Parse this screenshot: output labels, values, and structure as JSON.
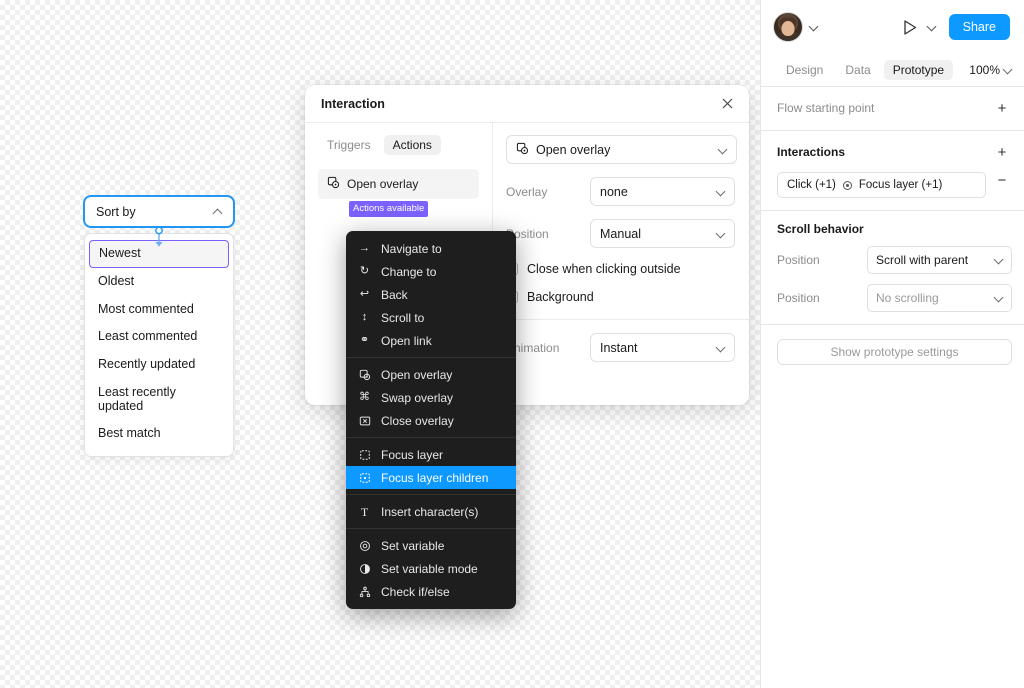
{
  "canvas": {
    "sort_dropdown": {
      "trigger_label": "Sort by",
      "caret_icon": "chevron-up-icon",
      "options": [
        "Newest",
        "Oldest",
        "Most commented",
        "Least commented",
        "Recently updated",
        "Least recently updated",
        "Best match"
      ],
      "selected_option": "Newest",
      "selection_color": "#2196f3",
      "option_highlight_color": "#7b61ff"
    }
  },
  "interaction_dialog": {
    "title": "Interaction",
    "close_icon": "close-icon",
    "tabs": [
      {
        "label": "Triggers",
        "active": false
      },
      {
        "label": "Actions",
        "active": true
      }
    ],
    "action_item": {
      "label": "Open overlay",
      "icon": "open-overlay-icon"
    },
    "badge": "Actions available",
    "badge_color": "#7b61ff",
    "add_node_icon": "add-interaction-icon",
    "action_select": {
      "label": "Open overlay",
      "icon": "open-overlay-icon",
      "caret_icon": "chevron-down-icon"
    },
    "fields": [
      {
        "name": "Overlay",
        "value": "none"
      },
      {
        "name": "Position",
        "value": "Manual"
      }
    ],
    "checkboxes": [
      {
        "label": "Close when clicking outside",
        "checked": false
      },
      {
        "label": "Background",
        "checked": false
      }
    ],
    "animation": {
      "name": "Animation",
      "value": "Instant"
    }
  },
  "action_menu": {
    "groups": [
      {
        "items": [
          {
            "label": "Navigate to",
            "icon": "arrow-right-icon",
            "glyph": "→",
            "highlight": false
          },
          {
            "label": "Change to",
            "icon": "swap-circular-icon",
            "glyph": "↻",
            "highlight": false
          },
          {
            "label": "Back",
            "icon": "arrow-back-icon",
            "glyph": "↩",
            "highlight": false
          },
          {
            "label": "Scroll to",
            "icon": "scroll-to-icon",
            "glyph": "↕",
            "highlight": false
          },
          {
            "label": "Open link",
            "icon": "link-icon",
            "glyph": "⚭",
            "highlight": false
          }
        ]
      },
      {
        "items": [
          {
            "label": "Open overlay",
            "icon": "open-overlay-icon",
            "glyph": "⧉",
            "highlight": false
          },
          {
            "label": "Swap overlay",
            "icon": "swap-overlay-icon",
            "glyph": "⌘",
            "highlight": false
          },
          {
            "label": "Close overlay",
            "icon": "close-overlay-icon",
            "glyph": "⊠",
            "highlight": false
          }
        ]
      },
      {
        "items": [
          {
            "label": "Focus layer",
            "icon": "focus-layer-icon",
            "glyph": "⬚",
            "highlight": false
          },
          {
            "label": "Focus layer children",
            "icon": "focus-layer-children-icon",
            "glyph": "⬚",
            "highlight": true
          }
        ]
      },
      {
        "items": [
          {
            "label": "Insert character(s)",
            "icon": "text-icon",
            "glyph": "T",
            "highlight": false
          }
        ]
      },
      {
        "items": [
          {
            "label": "Set variable",
            "icon": "set-variable-icon",
            "glyph": "◎",
            "highlight": false
          },
          {
            "label": "Set variable mode",
            "icon": "set-variable-mode-icon",
            "glyph": "◔",
            "highlight": false
          },
          {
            "label": "Check if/else",
            "icon": "branch-icon",
            "glyph": "⑂",
            "highlight": false
          }
        ]
      }
    ],
    "highlight_color": "#0d99ff"
  },
  "right_panel": {
    "avatar_icon": "avatar",
    "avatar_caret_icon": "chevron-down-icon",
    "play_icon": "play-icon",
    "play_caret_icon": "chevron-down-icon",
    "share_label": "Share",
    "share_color": "#0d99ff",
    "tabs": [
      {
        "label": "Design",
        "active": false
      },
      {
        "label": "Data",
        "active": false
      },
      {
        "label": "Prototype",
        "active": true
      }
    ],
    "zoom_level": "100%",
    "zoom_caret_icon": "chevron-down-icon",
    "flow_section": {
      "title": "Flow starting point",
      "add_icon": "plus-icon",
      "add_label": "+"
    },
    "interactions_section": {
      "title": "Interactions",
      "add_icon": "plus-icon",
      "add_label": "+",
      "item": {
        "trigger": "Click (+1)",
        "target_icon": "target-icon",
        "action": "Focus layer (+1)"
      },
      "remove_label": "−",
      "remove_icon": "minus-icon"
    },
    "scroll_section": {
      "title": "Scroll behavior",
      "rows": [
        {
          "name": "Position",
          "value": "Scroll with parent",
          "muted": false
        },
        {
          "name": "Position",
          "value": "No scrolling",
          "muted": true
        }
      ]
    },
    "show_settings_label": "Show prototype settings"
  }
}
